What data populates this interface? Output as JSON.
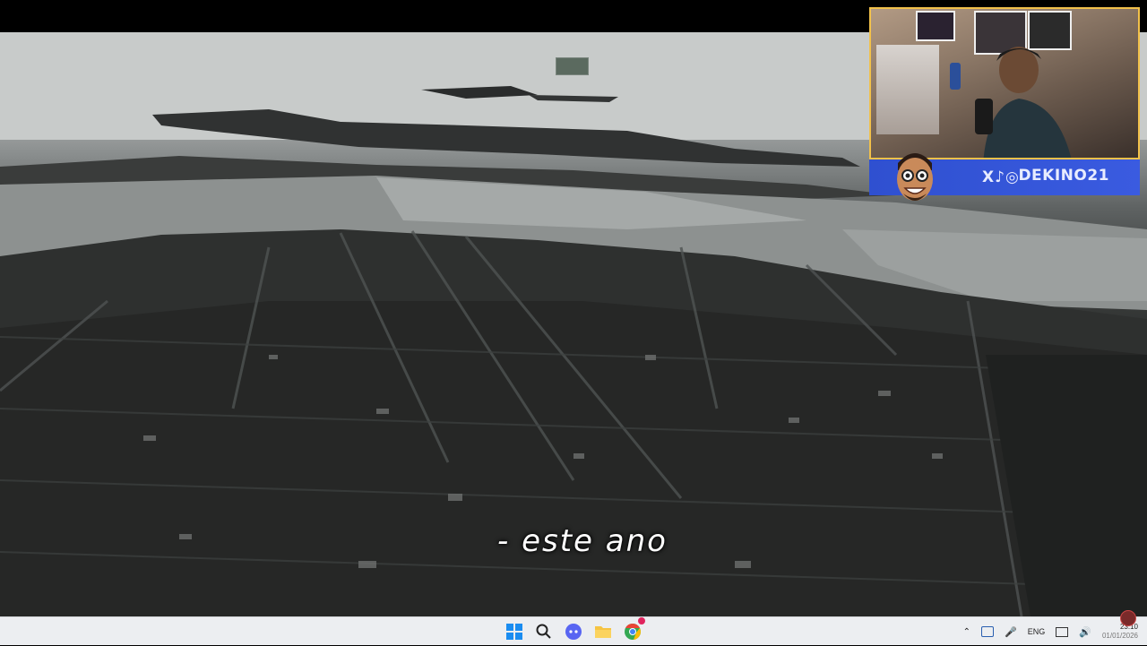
{
  "video": {
    "subtitle": "- este ano"
  },
  "webcam_overlay": {
    "streamer_name": "DEKINO21",
    "social_icons_text": "X♪◎",
    "social_icons": [
      "x-icon",
      "tiktok-icon",
      "instagram-icon"
    ],
    "accent_color": "#3a5be0",
    "border_color": "#f2c14a"
  },
  "taskbar": {
    "apps": [
      {
        "name": "start-button",
        "icon": "windows-logo-icon"
      },
      {
        "name": "search-button",
        "icon": "search-icon"
      },
      {
        "name": "app-button-discord",
        "icon": "discord-icon"
      },
      {
        "name": "app-button-file-explorer",
        "icon": "folder-icon"
      },
      {
        "name": "app-button-chrome",
        "icon": "chrome-icon"
      }
    ],
    "tray": {
      "language": "ENG",
      "time": "23:10",
      "date": "01/01/2026"
    }
  }
}
